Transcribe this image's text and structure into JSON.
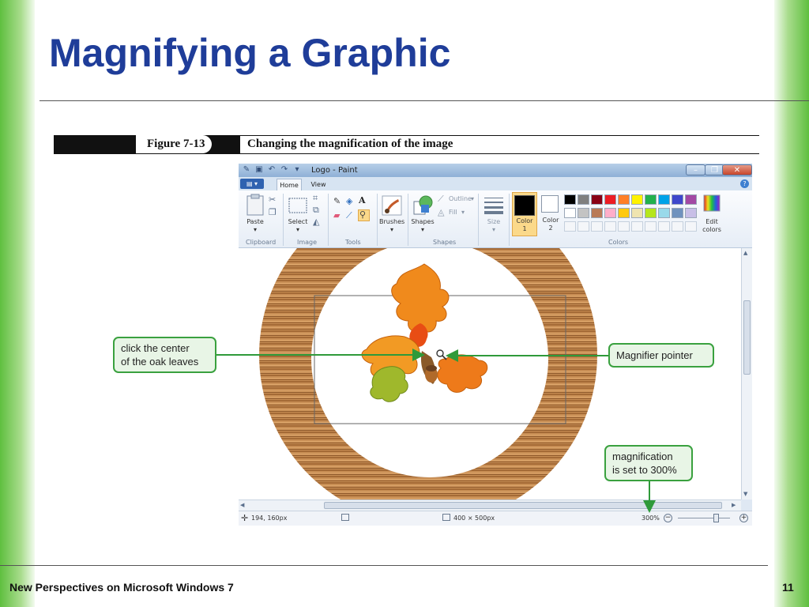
{
  "slide": {
    "title": "Magnifying a Graphic",
    "footer": "New Perspectives on Microsoft Windows 7",
    "page_number": "11",
    "accent_color": "#1f3d99",
    "side_bar_color": "#5fbf3f"
  },
  "figure": {
    "label": "Figure 7-13",
    "caption": "Changing the magnification of the image"
  },
  "paint": {
    "window_title": "Logo - Paint",
    "tabs": [
      "Home",
      "View"
    ],
    "active_tab": "Home",
    "groups": {
      "clipboard": "Clipboard",
      "image": "Image",
      "tools": "Tools",
      "shapes": "Shapes",
      "colors": "Colors"
    },
    "buttons": {
      "paste": "Paste",
      "select": "Select",
      "brushes": "Brushes",
      "shapes": "Shapes",
      "outline": "Outline",
      "fill": "Fill",
      "size": "Size",
      "color1": "Color",
      "color1_num": "1",
      "color2": "Color",
      "color2_num": "2",
      "edit_colors": "Edit",
      "edit_colors2": "colors"
    },
    "palette_row1": [
      "#000000",
      "#7f7f7f",
      "#880015",
      "#ed1c24",
      "#ff7f27",
      "#fff200",
      "#22b14c",
      "#00a2e8",
      "#3f48cc",
      "#a349a4"
    ],
    "palette_row2": [
      "#ffffff",
      "#c3c3c3",
      "#b97a57",
      "#ffaec9",
      "#ffc90e",
      "#efe4b0",
      "#b5e61d",
      "#99d9ea",
      "#7092be",
      "#c8bfe7"
    ],
    "status": {
      "cursor_position": "194, 160px",
      "image_size": "400 × 500px",
      "zoom": "300%"
    },
    "zoom_level": 300
  },
  "callouts": {
    "left_line1": "click the center",
    "left_line2": "of the oak leaves",
    "right": "Magnifier pointer",
    "bottom_line1": "magnification",
    "bottom_line2": "is set to 300%"
  }
}
